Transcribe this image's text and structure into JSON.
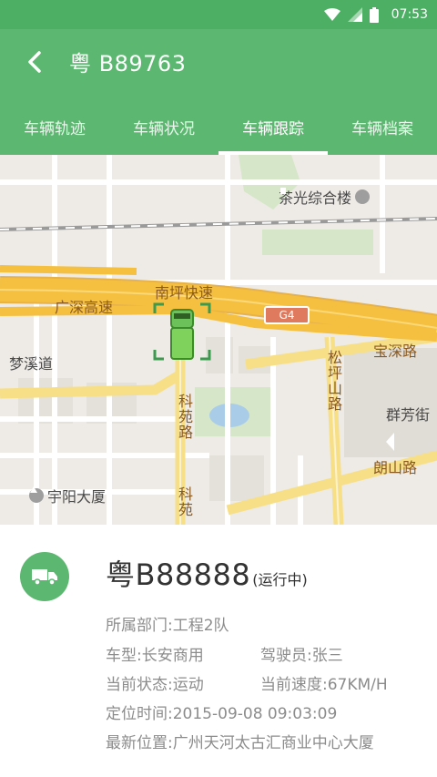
{
  "status_bar": {
    "time": "07:53",
    "icons": [
      "wifi-icon",
      "signal-icon",
      "battery-icon"
    ]
  },
  "header": {
    "title": "粤 B89763",
    "back_icon": "back-arrow-icon"
  },
  "tabs": [
    {
      "label": "车辆轨迹",
      "active": false
    },
    {
      "label": "车辆状况",
      "active": false
    },
    {
      "label": "车辆跟踪",
      "active": true
    },
    {
      "label": "车辆档案",
      "active": false
    }
  ],
  "map": {
    "labels": {
      "chaguang": "茶光综合楼",
      "nanping": "南坪快速",
      "guangshen": "广深高速",
      "g4": "G4",
      "baoshen": "宝深路",
      "mengxi": "梦溪道",
      "songping": "松坪山路",
      "keyuan1": "科苑路",
      "keyuan2": "科苑",
      "qunfang": "群芳街",
      "langshan": "朗山路",
      "yuyang": "宇阳大厦"
    }
  },
  "vehicle_info": {
    "plate": "粤B88888",
    "status": "(运行中)",
    "department": "所属部门:工程2队",
    "model": "车型:长安商用",
    "driver": "驾驶员:张三",
    "state": "当前状态:运动",
    "speed": "当前速度:67KM/H",
    "locate_time": "定位时间:2015-09-08 09:03:09",
    "location": "最新位置:广州天河太古汇商业中心大厦"
  },
  "colors": {
    "primary": "#5cb870",
    "status_bar": "#4caf64",
    "highway": "#f5c040"
  }
}
